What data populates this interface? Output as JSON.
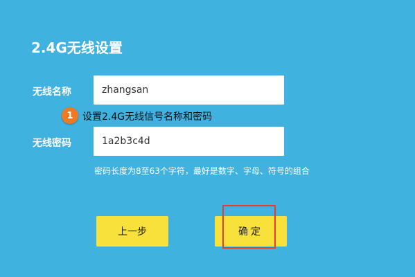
{
  "page": {
    "title": "2.4G无线设置",
    "background_color": "#3fb2e0"
  },
  "form": {
    "ssid": {
      "label": "无线名称",
      "value": "zhangsan"
    },
    "password": {
      "label": "无线密码",
      "value": "1a2b3c4d",
      "hint": "密码长度为8至63个字符，最好是数字、字母、符号的组合"
    }
  },
  "annotation": {
    "step_number": "1",
    "text": "设置2.4G无线信号名称和密码",
    "badge_color": "#f07a22"
  },
  "buttons": {
    "prev_label": "上一步",
    "ok_label": "确定",
    "button_color": "#f9e13b"
  },
  "highlight": {
    "color": "#e0402c",
    "target": "ok-button"
  }
}
